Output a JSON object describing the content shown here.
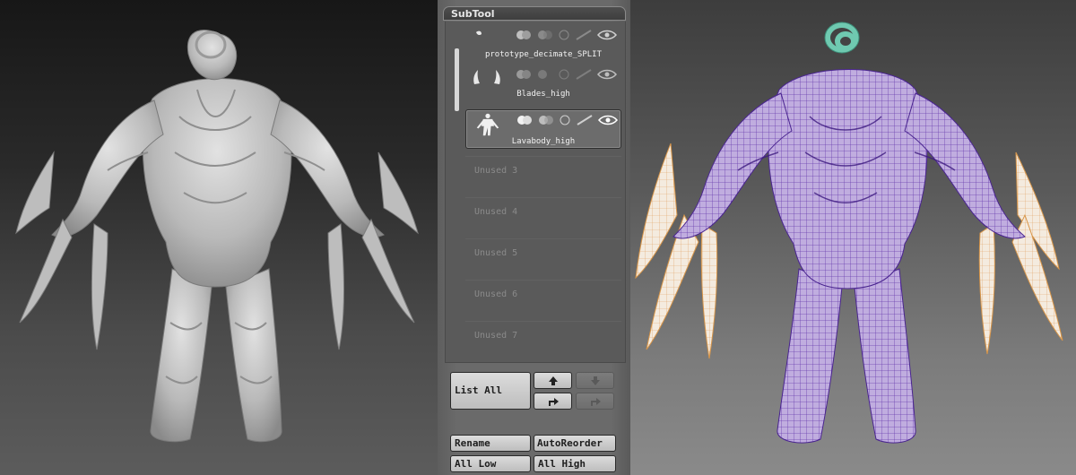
{
  "panel": {
    "title": "SubTool",
    "subtools": [
      {
        "name": "prototype_decimate_SPLIT",
        "selected": false
      },
      {
        "name": "Blades_high",
        "selected": false
      },
      {
        "name": "Lavabody_high",
        "selected": true
      }
    ],
    "unused": [
      "Unused 3",
      "Unused 4",
      "Unused 5",
      "Unused 6",
      "Unused 7"
    ],
    "buttons": {
      "list_all": "List All",
      "rename": "Rename",
      "auto_reorder": "AutoReorder",
      "all_low": "All Low",
      "all_high": "All High"
    },
    "icons": {
      "move_up": "arrow-up-icon",
      "move_down": "arrow-down-icon",
      "move_to": "arrow-turn-icon",
      "move_left": "arrow-turn-icon"
    }
  },
  "viewports": {
    "left": {
      "render_style": "grey clay sculpt",
      "model_color": "#c9c9c9"
    },
    "right": {
      "render_style": "wireframe polygroups",
      "body_color": "#a58fd0",
      "blade_color": "#f2e6d8",
      "horn_color": "#8fd9c4",
      "wire_color": "#5a2fa0"
    }
  }
}
